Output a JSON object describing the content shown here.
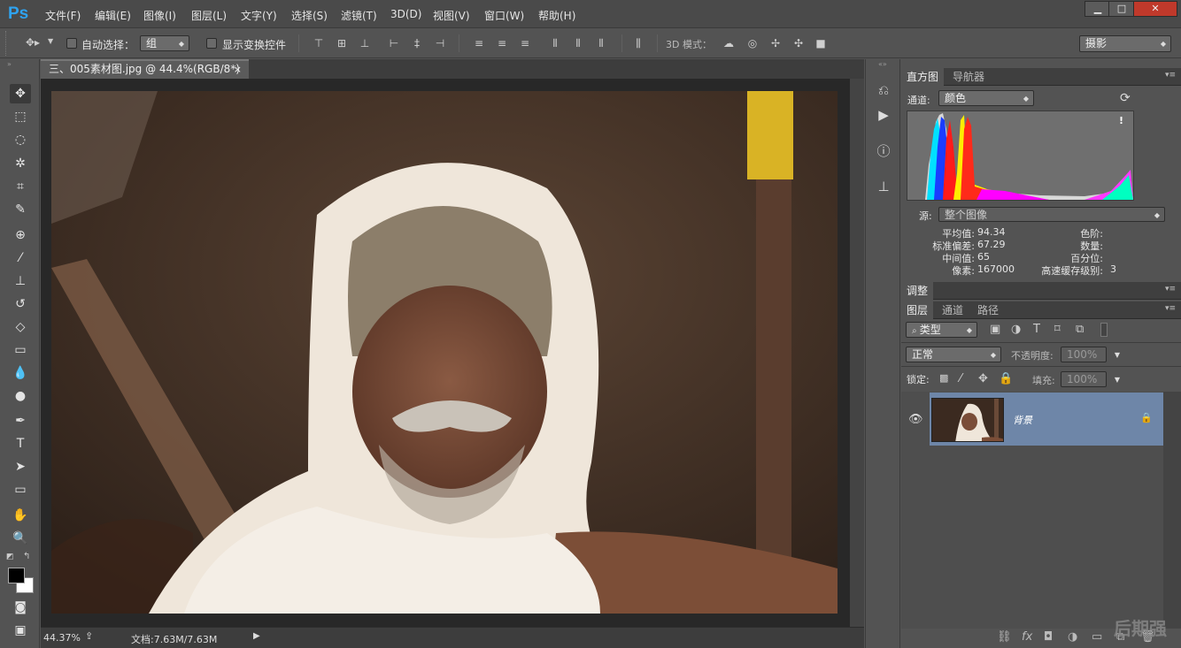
{
  "app": {
    "logo": "Ps"
  },
  "menu": [
    "文件(F)",
    "编辑(E)",
    "图像(I)",
    "图层(L)",
    "文字(Y)",
    "选择(S)",
    "滤镜(T)",
    "3D(D)",
    "视图(V)",
    "窗口(W)",
    "帮助(H)"
  ],
  "window_controls": {
    "minimize": "▁",
    "maximize": "□",
    "close": "✕"
  },
  "options": {
    "auto_select_label": "自动选择：",
    "auto_select_value": "组",
    "show_transform_label": "显示变换控件",
    "mode3d_label": "3D 模式：",
    "workspace": "摄影"
  },
  "document": {
    "tab_title": "三、005素材图.jpg @ 44.4%(RGB/8*)",
    "close": "×",
    "zoom": "44.37%",
    "doc_size": "文档:7.63M/7.63M"
  },
  "histogram": {
    "tabs": [
      "直方图",
      "导航器"
    ],
    "channel_label": "通道:",
    "channel_value": "颜色",
    "warning": "!",
    "source_label": "源:",
    "source_value": "整个图像",
    "stats_left": [
      {
        "label": "平均值:",
        "value": "94.34"
      },
      {
        "label": "标准偏差:",
        "value": "67.29"
      },
      {
        "label": "中间值:",
        "value": "65"
      },
      {
        "label": "像素:",
        "value": "167000"
      }
    ],
    "stats_right": [
      {
        "label": "色阶:",
        "value": ""
      },
      {
        "label": "数量:",
        "value": ""
      },
      {
        "label": "百分位:",
        "value": ""
      },
      {
        "label": "高速缓存级别:",
        "value": "3"
      }
    ]
  },
  "adjust": {
    "tab": "调整"
  },
  "layers": {
    "tabs": [
      "图层",
      "通道",
      "路径"
    ],
    "filter_value": "类型",
    "blend_mode": "正常",
    "opacity_label": "不透明度:",
    "opacity_value": "100%",
    "lock_label": "锁定:",
    "fill_label": "填充:",
    "fill_value": "100%",
    "layer_name": "背景"
  },
  "watermark": "后期强"
}
